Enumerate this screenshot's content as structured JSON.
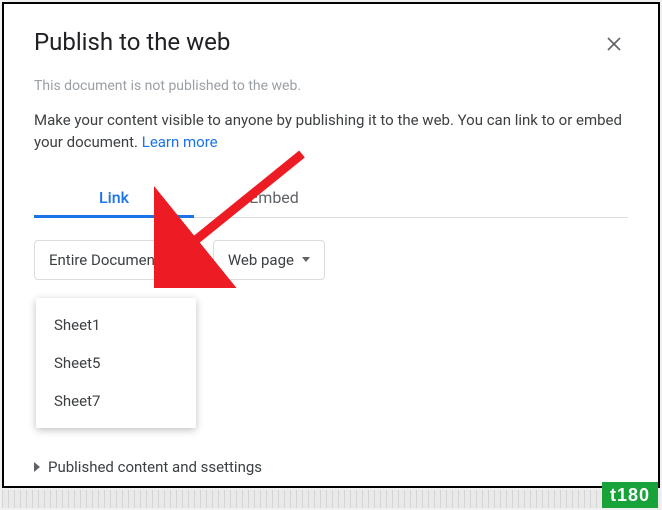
{
  "dialog": {
    "title": "Publish to the web",
    "not_published": "This document is not published to the web.",
    "description": "Make your content visible to anyone by publishing it to the web. You can link to or embed your document. ",
    "learn_more": "Learn more"
  },
  "tabs": {
    "link": "Link",
    "embed": "Embed"
  },
  "dropdowns": {
    "scope_label": "Entire Document",
    "format_label": "Web page",
    "options": [
      "Sheet1",
      "Sheet5",
      "Sheet7"
    ]
  },
  "expander": {
    "label": "Published content and ssettings"
  },
  "badge": {
    "text": "t180"
  },
  "colors": {
    "link_blue": "#1a73e8",
    "badge_green": "#17a33a",
    "arrow_red": "#ed1c24"
  }
}
